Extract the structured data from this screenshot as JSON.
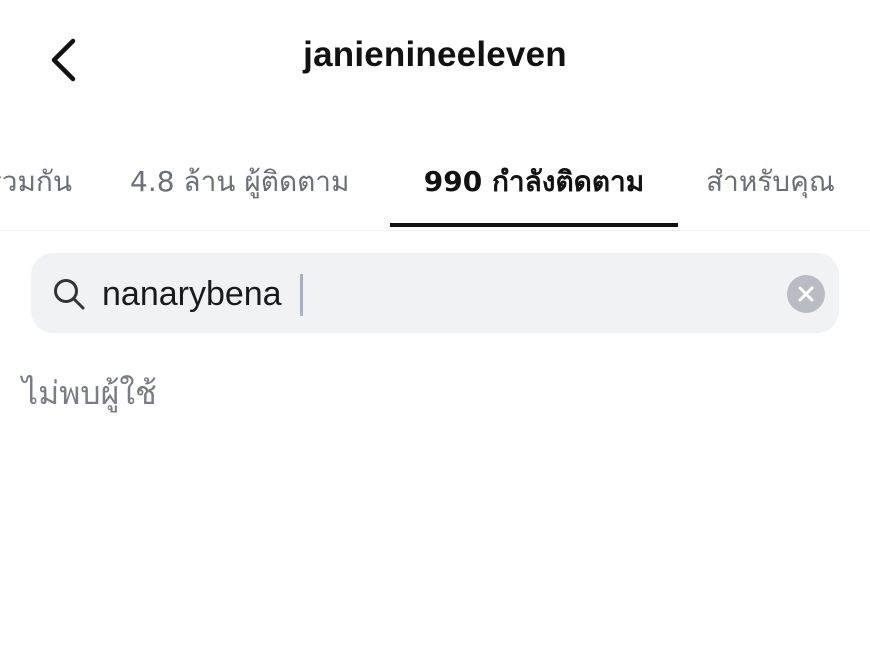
{
  "header": {
    "back_icon": "chevron-left-icon",
    "title": "janienineeleven"
  },
  "tabs": [
    {
      "label": "ร่วมกัน",
      "selected": false
    },
    {
      "label": "4.8 ล้าน ผู้ติดตาม",
      "selected": false
    },
    {
      "label": "990 กำลังติดตาม",
      "selected": true
    },
    {
      "label": "สำหรับคุณ",
      "selected": false
    }
  ],
  "search": {
    "icon": "search-icon",
    "value": "nanarybena",
    "clear_icon": "clear-icon"
  },
  "results": {
    "empty_message": "ไม่พบผู้ใช้"
  },
  "colors": {
    "active_tab": "#111111",
    "inactive_tab": "#6b6f77",
    "search_background": "#f1f2f4",
    "clear_button": "#b9bcc2",
    "empty_text": "#7a7d84"
  }
}
